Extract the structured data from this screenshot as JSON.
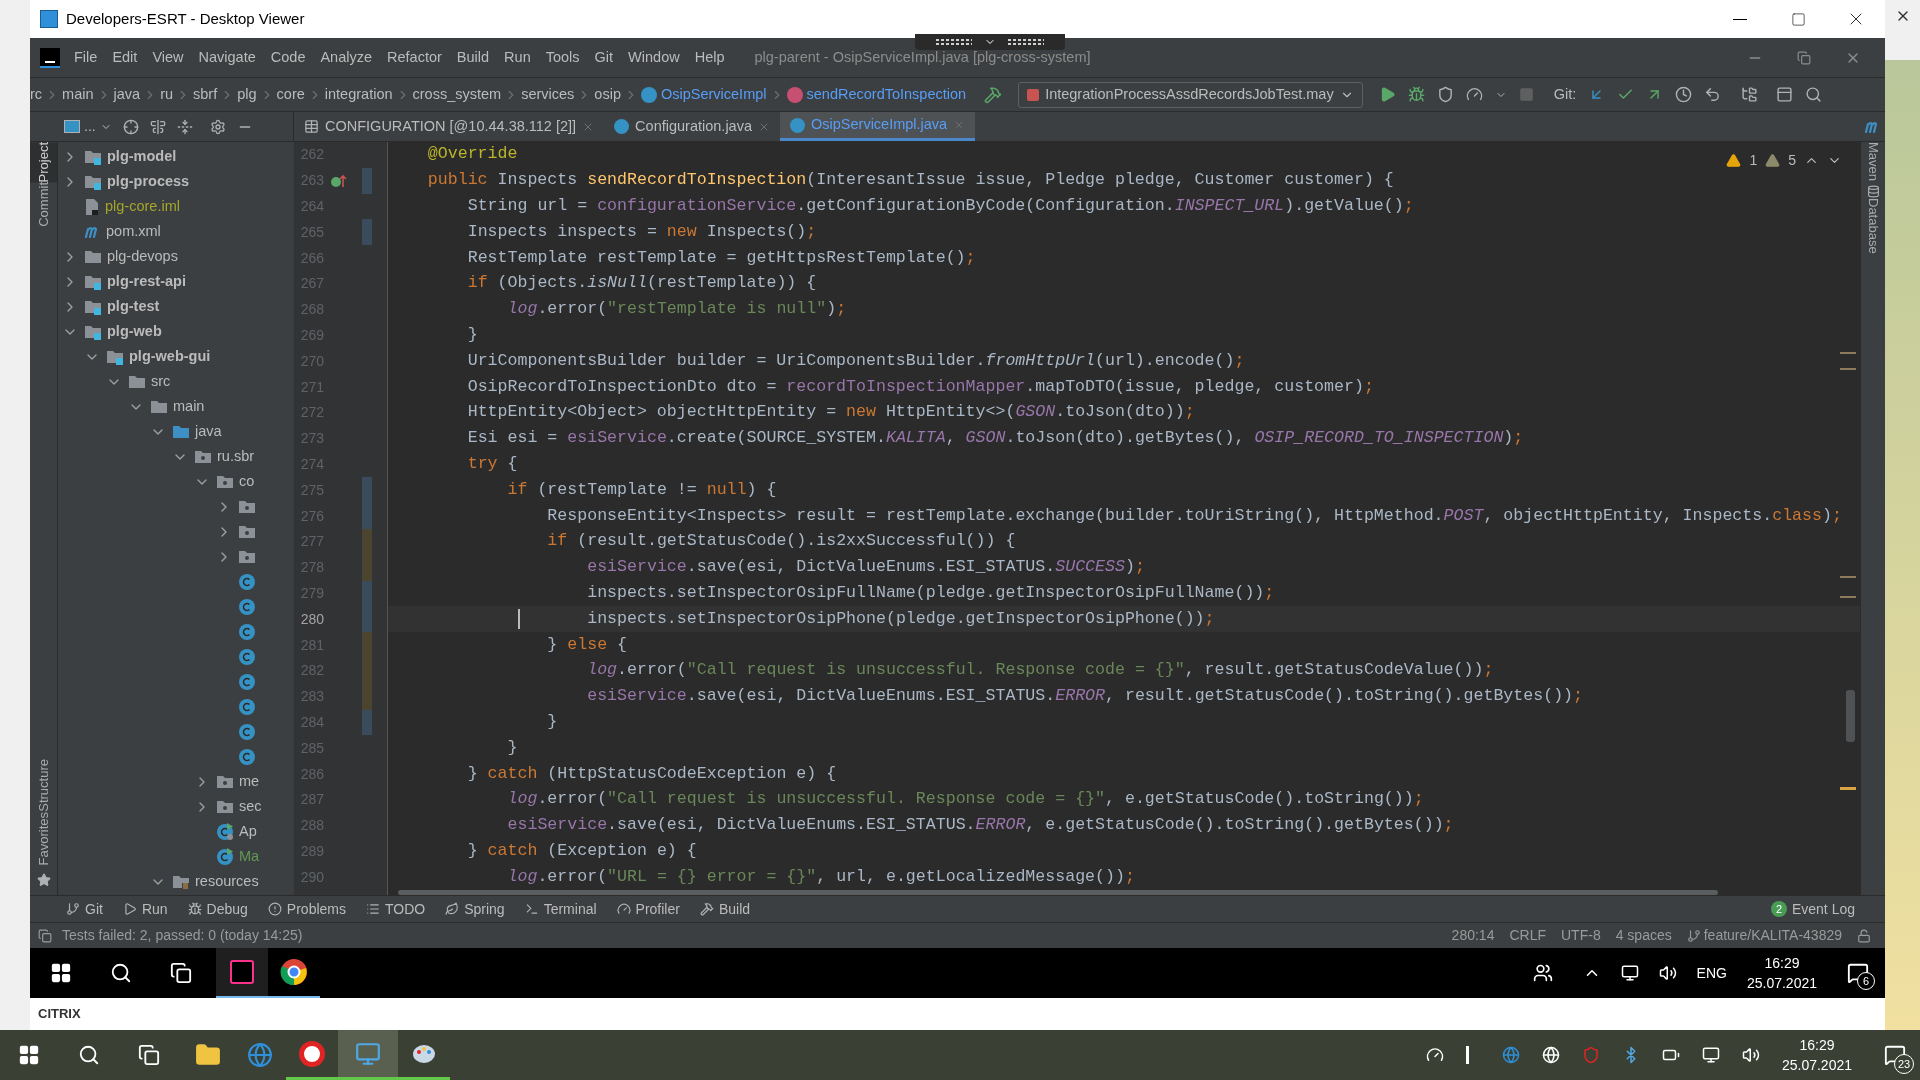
{
  "viewer": {
    "title": "Developers-ESRT - Desktop Viewer"
  },
  "menu": [
    "File",
    "Edit",
    "View",
    "Navigate",
    "Code",
    "Analyze",
    "Refactor",
    "Build",
    "Run",
    "Tools",
    "Git",
    "Window",
    "Help"
  ],
  "ide_title": "plg-parent - OsipServiceImpl.java [plg-cross-system]",
  "breadcrumbs": [
    {
      "text": "rc",
      "kind": "plain"
    },
    {
      "text": "main",
      "kind": "plain"
    },
    {
      "text": "java",
      "kind": "plain"
    },
    {
      "text": "ru",
      "kind": "plain"
    },
    {
      "text": "sbrf",
      "kind": "plain"
    },
    {
      "text": "plg",
      "kind": "plain"
    },
    {
      "text": "core",
      "kind": "plain"
    },
    {
      "text": "integration",
      "kind": "plain"
    },
    {
      "text": "cross_system",
      "kind": "plain"
    },
    {
      "text": "services",
      "kind": "plain"
    },
    {
      "text": "osip",
      "kind": "plain"
    },
    {
      "text": "OsipServiceImpl",
      "kind": "class"
    },
    {
      "text": "sendRecordToInspection",
      "kind": "method"
    }
  ],
  "run_config": "IntegrationProcessAssdRecordsJobTest.may",
  "git_label": "Git:",
  "project_header": "...",
  "tabs": [
    {
      "label": "CONFIGURATION [@10.44.38.112 [2]]",
      "kind": "table",
      "selected": false
    },
    {
      "label": "Configuration.java",
      "kind": "class",
      "selected": false
    },
    {
      "label": "OsipServiceImpl.java",
      "kind": "class",
      "selected": true
    }
  ],
  "left_stripe": [
    {
      "label": "Project",
      "selected": true
    },
    {
      "label": "Commit",
      "selected": false
    },
    {
      "label": "Structure",
      "selected": false
    },
    {
      "label": "Favorites",
      "selected": false
    }
  ],
  "right_stripe": [
    {
      "label": "Maven"
    },
    {
      "label": "Database"
    }
  ],
  "tree": [
    {
      "children": [
        {
          "label": "plg-model",
          "kind": "module",
          "expanded": false
        },
        {
          "label": "plg-process",
          "kind": "module",
          "expanded": false
        },
        {
          "label": "plg-core.iml",
          "kind": "iml",
          "color": "#a5a52a"
        },
        {
          "label": "pom.xml",
          "kind": "pom"
        }
      ]
    },
    {
      "label": "plg-devops",
      "kind": "folder",
      "expanded": false
    },
    {
      "label": "plg-rest-api",
      "kind": "module",
      "expanded": false
    },
    {
      "label": "plg-test",
      "kind": "module",
      "expanded": false
    },
    {
      "label": "plg-web",
      "kind": "module",
      "expanded": true,
      "children": [
        {
          "label": "plg-web-gui",
          "kind": "module",
          "expanded": true,
          "children": [
            {
              "label": "src",
              "kind": "folder",
              "expanded": true,
              "children": [
                {
                  "label": "main",
                  "kind": "folder",
                  "expanded": true,
                  "children": [
                    {
                      "label": "java",
                      "kind": "source",
                      "expanded": true,
                      "children": [
                        {
                          "label": "ru.sbr",
                          "kind": "package",
                          "expanded": true,
                          "children": [
                            {
                              "label": "co",
                              "kind": "package",
                              "expanded": true,
                              "children": [
                                {
                                  "kind": "package",
                                  "expanded": false
                                },
                                {
                                  "kind": "package",
                                  "expanded": false
                                },
                                {
                                  "kind": "package",
                                  "expanded": false
                                },
                                {
                                  "kind": "class"
                                },
                                {
                                  "kind": "class"
                                },
                                {
                                  "kind": "class"
                                },
                                {
                                  "kind": "class"
                                },
                                {
                                  "kind": "class"
                                },
                                {
                                  "kind": "class"
                                },
                                {
                                  "kind": "class"
                                },
                                {
                                  "kind": "class"
                                }
                              ]
                            },
                            {
                              "label": "me",
                              "kind": "package",
                              "expanded": false
                            },
                            {
                              "label": "sec",
                              "kind": "package",
                              "expanded": false
                            },
                            {
                              "label": "Ap",
                              "kind": "app"
                            },
                            {
                              "label": "Ma",
                              "kind": "runnable",
                              "color": "#629755"
                            }
                          ]
                        }
                      ]
                    },
                    {
                      "label": "resources",
                      "kind": "resources",
                      "expanded": true
                    }
                  ]
                }
              ]
            }
          ]
        }
      ]
    }
  ],
  "inspections": {
    "errors": "1",
    "warnings": "5"
  },
  "code": [
    {
      "number": "262",
      "current": false,
      "override_marker": false,
      "tokens": [
        {
          "kind": "annotation",
          "text": "    @Override"
        }
      ]
    },
    {
      "number": "263",
      "current": false,
      "override_marker": true,
      "color": "#3a4b5c",
      "tokens": [
        {
          "kind": "keyword",
          "text": "    public"
        },
        {
          "kind": "plain",
          "text": " Inspects "
        },
        {
          "kind": "declaration",
          "text": "sendRecordToInspection"
        },
        {
          "kind": "plain",
          "text": "(InteresantIssue issue, Pledge pledge, Customer customer) {"
        }
      ]
    },
    {
      "number": "264",
      "current": false,
      "override_marker": false,
      "tokens": [
        {
          "kind": "plain",
          "text": "        String url = "
        },
        {
          "kind": "field",
          "text": "configurationService"
        },
        {
          "kind": "plain",
          "text": ".getConfigurationByCode(Configuration."
        },
        {
          "kind": "static",
          "text": "INSPECT_URL"
        },
        {
          "kind": "plain",
          "text": ").getValue()"
        },
        {
          "kind": "keyword",
          "text": ";"
        }
      ]
    },
    {
      "number": "265",
      "current": false,
      "override_marker": false,
      "color": "#3a4b5c",
      "tokens": [
        {
          "kind": "plain",
          "text": "        Inspects inspects = "
        },
        {
          "kind": "keyword",
          "text": "new"
        },
        {
          "kind": "plain",
          "text": " Inspects()"
        },
        {
          "kind": "keyword",
          "text": ";"
        }
      ]
    },
    {
      "number": "266",
      "current": false,
      "override_marker": false,
      "tokens": [
        {
          "kind": "plain",
          "text": "        RestTemplate restTemplate = getHttpsRestTemplate()"
        },
        {
          "kind": "keyword",
          "text": ";"
        }
      ]
    },
    {
      "number": "267",
      "current": false,
      "override_marker": false,
      "tokens": [
        {
          "kind": "keyword",
          "text": "        if"
        },
        {
          "kind": "plain",
          "text": " (Objects."
        },
        {
          "kind": "italic",
          "text": "isNull"
        },
        {
          "kind": "plain",
          "text": "(restTemplate)) {"
        }
      ]
    },
    {
      "number": "268",
      "current": false,
      "override_marker": false,
      "tokens": [
        {
          "kind": "static",
          "text": "            log"
        },
        {
          "kind": "plain",
          "text": ".error("
        },
        {
          "kind": "string",
          "text": "\"restTemplate is null\""
        },
        {
          "kind": "plain",
          "text": ")"
        },
        {
          "kind": "keyword",
          "text": ";"
        }
      ]
    },
    {
      "number": "269",
      "current": false,
      "override_marker": false,
      "tokens": [
        {
          "kind": "plain",
          "text": "        }"
        }
      ]
    },
    {
      "number": "270",
      "current": false,
      "override_marker": false,
      "tokens": [
        {
          "kind": "plain",
          "text": "        UriComponentsBuilder builder = UriComponentsBuilder."
        },
        {
          "kind": "italic",
          "text": "fromHttpUrl"
        },
        {
          "kind": "plain",
          "text": "(url).encode()"
        },
        {
          "kind": "keyword",
          "text": ";"
        }
      ]
    },
    {
      "number": "271",
      "current": false,
      "override_marker": false,
      "tokens": [
        {
          "kind": "plain",
          "text": "        OsipRecordToInspectionDto dto = "
        },
        {
          "kind": "field",
          "text": "recordToInspectionMapper"
        },
        {
          "kind": "plain",
          "text": ".mapToDTO(issue, pledge, customer)"
        },
        {
          "kind": "keyword",
          "text": ";"
        }
      ]
    },
    {
      "number": "272",
      "current": false,
      "override_marker": false,
      "tokens": [
        {
          "kind": "plain",
          "text": "        HttpEntity<Object> objectHttpEntity = "
        },
        {
          "kind": "keyword",
          "text": "new"
        },
        {
          "kind": "plain",
          "text": " HttpEntity<>("
        },
        {
          "kind": "static",
          "text": "GSON"
        },
        {
          "kind": "plain",
          "text": ".toJson(dto))"
        },
        {
          "kind": "keyword",
          "text": ";"
        }
      ]
    },
    {
      "number": "273",
      "current": false,
      "override_marker": false,
      "tokens": [
        {
          "kind": "plain",
          "text": "        Esi esi = "
        },
        {
          "kind": "field",
          "text": "esiService"
        },
        {
          "kind": "plain",
          "text": ".create(SOURCE_SYSTEM."
        },
        {
          "kind": "static",
          "text": "KALITA"
        },
        {
          "kind": "plain",
          "text": ", "
        },
        {
          "kind": "static",
          "text": "GSON"
        },
        {
          "kind": "plain",
          "text": ".toJson(dto).getBytes(), "
        },
        {
          "kind": "static",
          "text": "OSIP_RECORD_TO_INSPECTION"
        },
        {
          "kind": "plain",
          "text": ")"
        },
        {
          "kind": "keyword",
          "text": ";"
        }
      ]
    },
    {
      "number": "274",
      "current": false,
      "override_marker": false,
      "tokens": [
        {
          "kind": "keyword",
          "text": "        try"
        },
        {
          "kind": "plain",
          "text": " {"
        }
      ]
    },
    {
      "number": "275",
      "current": false,
      "override_marker": false,
      "color": "#3a4b5c",
      "tokens": [
        {
          "kind": "keyword",
          "text": "            if"
        },
        {
          "kind": "plain",
          "text": " (restTemplate != "
        },
        {
          "kind": "keyword",
          "text": "null"
        },
        {
          "kind": "plain",
          "text": ") {"
        }
      ]
    },
    {
      "number": "276",
      "current": false,
      "override_marker": false,
      "color": "#3a4b5c",
      "tokens": [
        {
          "kind": "plain",
          "text": "                ResponseEntity<Inspects> result = restTemplate.exchange(builder.toUriString(), HttpMethod."
        },
        {
          "kind": "static",
          "text": "POST"
        },
        {
          "kind": "plain",
          "text": ", objectHttpEntity, Inspects."
        },
        {
          "kind": "keyword",
          "text": "class"
        },
        {
          "kind": "plain",
          "text": ")"
        },
        {
          "kind": "keyword",
          "text": ";"
        }
      ]
    },
    {
      "number": "277",
      "current": false,
      "override_marker": false,
      "color": "#4b4530",
      "tokens": [
        {
          "kind": "keyword",
          "text": "                if"
        },
        {
          "kind": "plain",
          "text": " (result.getStatusCode().is2xxSuccessful()) {"
        }
      ]
    },
    {
      "number": "278",
      "current": false,
      "override_marker": false,
      "color": "#4b4530",
      "tokens": [
        {
          "kind": "field",
          "text": "                    esiService"
        },
        {
          "kind": "plain",
          "text": ".save(esi, DictValueEnums.ESI_STATUS."
        },
        {
          "kind": "static",
          "text": "SUCCESS"
        },
        {
          "kind": "plain",
          "text": ")"
        },
        {
          "kind": "keyword",
          "text": ";"
        }
      ]
    },
    {
      "number": "279",
      "current": false,
      "override_marker": false,
      "color": "#3a4b5c",
      "tokens": [
        {
          "kind": "plain",
          "text": "                    inspects.setInspectorOsipFullName(pledge.getInspectorOsipFullName())"
        },
        {
          "kind": "keyword",
          "text": ";"
        }
      ]
    },
    {
      "number": "280",
      "current": true,
      "override_marker": false,
      "color": "#3a4b5c",
      "tokens": [
        {
          "kind": "plain",
          "text": "                    inspects.setInspectorOsipPhone(pledge.getInspectorOsipPhone())"
        },
        {
          "kind": "keyword",
          "text": ";"
        }
      ]
    },
    {
      "number": "281",
      "current": false,
      "override_marker": false,
      "color": "#4b4530",
      "tokens": [
        {
          "kind": "plain",
          "text": "                } "
        },
        {
          "kind": "keyword",
          "text": "else"
        },
        {
          "kind": "plain",
          "text": " {"
        }
      ]
    },
    {
      "number": "282",
      "current": false,
      "override_marker": false,
      "color": "#4b4530",
      "tokens": [
        {
          "kind": "static",
          "text": "                    log"
        },
        {
          "kind": "plain",
          "text": ".error("
        },
        {
          "kind": "string",
          "text": "\"Call request is unsuccessful. Response code = {}\""
        },
        {
          "kind": "plain",
          "text": ", result.getStatusCodeValue())"
        },
        {
          "kind": "keyword",
          "text": ";"
        }
      ]
    },
    {
      "number": "283",
      "current": false,
      "override_marker": false,
      "color": "#4b4530",
      "tokens": [
        {
          "kind": "field",
          "text": "                    esiService"
        },
        {
          "kind": "plain",
          "text": ".save(esi, DictValueEnums.ESI_STATUS."
        },
        {
          "kind": "static",
          "text": "ERROR"
        },
        {
          "kind": "plain",
          "text": ", result.getStatusCode().toString().getBytes())"
        },
        {
          "kind": "keyword",
          "text": ";"
        }
      ]
    },
    {
      "number": "284",
      "current": false,
      "override_marker": false,
      "color": "#3a4b5c",
      "tokens": [
        {
          "kind": "plain",
          "text": "                }"
        }
      ]
    },
    {
      "number": "285",
      "current": false,
      "override_marker": false,
      "tokens": [
        {
          "kind": "plain",
          "text": "            }"
        }
      ]
    },
    {
      "number": "286",
      "current": false,
      "override_marker": false,
      "tokens": [
        {
          "kind": "plain",
          "text": "        } "
        },
        {
          "kind": "keyword",
          "text": "catch"
        },
        {
          "kind": "plain",
          "text": " (HttpStatusCodeException e) {"
        }
      ]
    },
    {
      "number": "287",
      "current": false,
      "override_marker": false,
      "tokens": [
        {
          "kind": "static",
          "text": "            log"
        },
        {
          "kind": "plain",
          "text": ".error("
        },
        {
          "kind": "string",
          "text": "\"Call request is unsuccessful. Response code = {}\""
        },
        {
          "kind": "plain",
          "text": ", e.getStatusCode().toString())"
        },
        {
          "kind": "keyword",
          "text": ";"
        }
      ]
    },
    {
      "number": "288",
      "current": false,
      "override_marker": false,
      "tokens": [
        {
          "kind": "field",
          "text": "            esiService"
        },
        {
          "kind": "plain",
          "text": ".save(esi, DictValueEnums.ESI_STATUS."
        },
        {
          "kind": "static",
          "text": "ERROR"
        },
        {
          "kind": "plain",
          "text": ", e.getStatusCode().toString().getBytes())"
        },
        {
          "kind": "keyword",
          "text": ";"
        }
      ]
    },
    {
      "number": "289",
      "current": false,
      "override_marker": false,
      "tokens": [
        {
          "kind": "plain",
          "text": "        } "
        },
        {
          "kind": "keyword",
          "text": "catch"
        },
        {
          "kind": "plain",
          "text": " (Exception e) {"
        }
      ]
    },
    {
      "number": "290",
      "current": false,
      "override_marker": false,
      "tokens": [
        {
          "kind": "static",
          "text": "            log"
        },
        {
          "kind": "plain",
          "text": ".error("
        },
        {
          "kind": "string",
          "text": "\"URL = {} error = {}\""
        },
        {
          "kind": "plain",
          "text": ", url, e.getLocalizedMessage())"
        },
        {
          "kind": "keyword",
          "text": ";"
        }
      ]
    }
  ],
  "tool_windows": [
    "Git",
    "Run",
    "Debug",
    "Problems",
    "TODO",
    "Spring",
    "Terminal",
    "Profiler",
    "Build"
  ],
  "event_log": {
    "count": "2",
    "label": "Event Log"
  },
  "status": {
    "message": "Tests failed: 2, passed: 0 (today 14:25)",
    "position": "280:14",
    "line_separator": "CRLF",
    "encoding": "UTF-8",
    "indent": "4 spaces",
    "branch": "feature/KALITA-43829"
  },
  "remote_taskbar": {
    "language": "ENG",
    "time": "16:29",
    "date": "25.07.2021",
    "notifications": "6"
  },
  "citrix_logo": "CITRIX",
  "local_taskbar": {
    "time": "16:29",
    "date": "25.07.2021",
    "notifications": "23"
  }
}
